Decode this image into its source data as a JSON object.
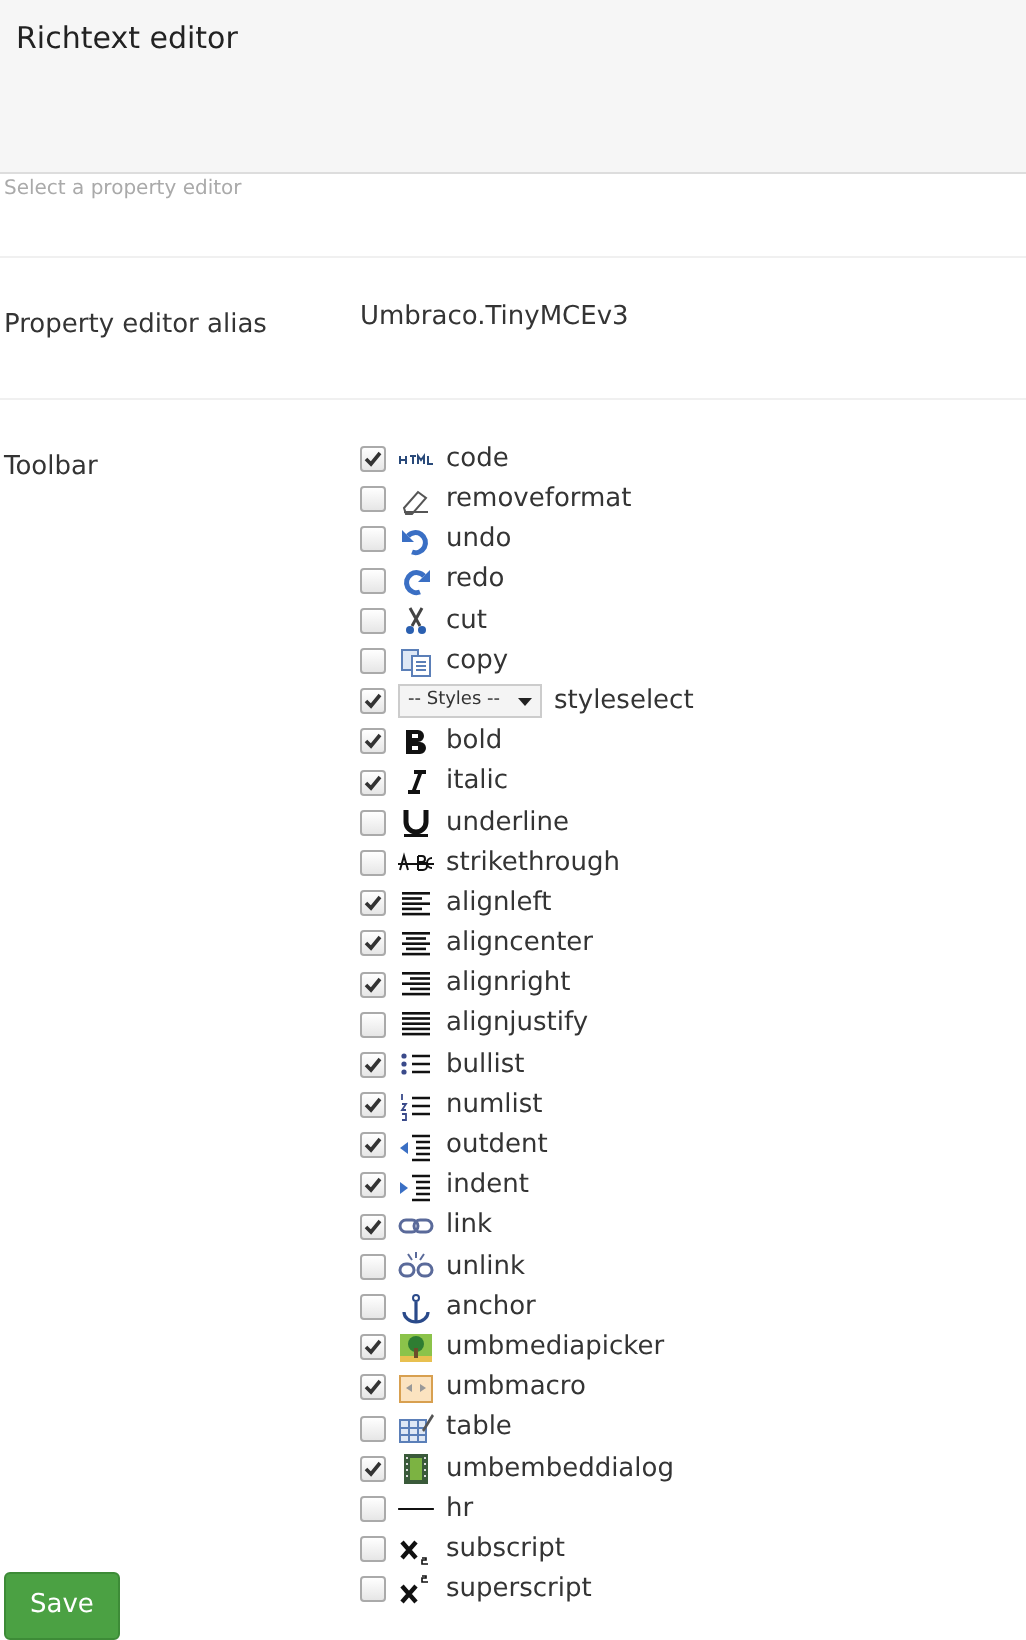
{
  "header": {
    "title": "Richtext editor",
    "hint": "Select a property editor"
  },
  "alias": {
    "label": "Property editor alias",
    "value": "Umbraco.TinyMCEv3"
  },
  "toolbar": {
    "label": "Toolbar",
    "items": [
      {
        "label": "code",
        "checked": true,
        "kind": "button"
      },
      {
        "label": "removeformat",
        "checked": false,
        "kind": "button"
      },
      {
        "label": "undo",
        "checked": false,
        "kind": "button"
      },
      {
        "label": "redo",
        "checked": false,
        "kind": "button"
      },
      {
        "label": "cut",
        "checked": false,
        "kind": "button"
      },
      {
        "label": "copy",
        "checked": false,
        "kind": "button"
      },
      {
        "label": "styleselect",
        "checked": true,
        "kind": "select",
        "select_label": "-- Styles --"
      },
      {
        "label": "bold",
        "checked": true,
        "kind": "button"
      },
      {
        "label": "italic",
        "checked": true,
        "kind": "button"
      },
      {
        "label": "underline",
        "checked": false,
        "kind": "button"
      },
      {
        "label": "strikethrough",
        "checked": false,
        "kind": "button"
      },
      {
        "label": "alignleft",
        "checked": true,
        "kind": "button"
      },
      {
        "label": "aligncenter",
        "checked": true,
        "kind": "button"
      },
      {
        "label": "alignright",
        "checked": true,
        "kind": "button"
      },
      {
        "label": "alignjustify",
        "checked": false,
        "kind": "button"
      },
      {
        "label": "bullist",
        "checked": true,
        "kind": "button"
      },
      {
        "label": "numlist",
        "checked": true,
        "kind": "button"
      },
      {
        "label": "outdent",
        "checked": true,
        "kind": "button"
      },
      {
        "label": "indent",
        "checked": true,
        "kind": "button"
      },
      {
        "label": "link",
        "checked": true,
        "kind": "button"
      },
      {
        "label": "unlink",
        "checked": false,
        "kind": "button"
      },
      {
        "label": "anchor",
        "checked": false,
        "kind": "button"
      },
      {
        "label": "umbmediapicker",
        "checked": true,
        "kind": "button"
      },
      {
        "label": "umbmacro",
        "checked": true,
        "kind": "button"
      },
      {
        "label": "table",
        "checked": false,
        "kind": "button"
      },
      {
        "label": "umbembeddialog",
        "checked": true,
        "kind": "button"
      },
      {
        "label": "hr",
        "checked": false,
        "kind": "button"
      },
      {
        "label": "subscript",
        "checked": false,
        "kind": "button"
      },
      {
        "label": "superscript",
        "checked": false,
        "kind": "button"
      }
    ]
  },
  "save_button": "Save"
}
